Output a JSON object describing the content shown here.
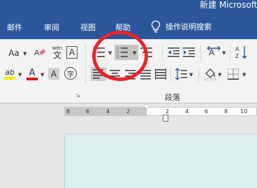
{
  "window": {
    "title": "新建 Microsoft"
  },
  "tabs": [
    "邮件",
    "审阅",
    "视图",
    "帮助"
  ],
  "tellme": {
    "label": "操作说明搜索",
    "icon": "lightbulb-icon"
  },
  "ribbon": {
    "font_group": {
      "font_size_icon": "Aa",
      "clear_format_icon": "eraser-icon",
      "phonetic_icon": "wén",
      "phonetic_char": "文",
      "char_border_icon": "A",
      "char_enclose_icon": "字",
      "highlight_icon": "ab",
      "highlight_color": "#f5ec00",
      "font_color_icon": "A",
      "font_color": "#d7191c",
      "char_shading_icon": "A"
    },
    "paragraph_group": {
      "label": "段落"
    }
  },
  "ruler": {
    "ticks": [
      "8",
      "6",
      "4",
      "2",
      "2",
      "4",
      "6",
      "8",
      "10"
    ]
  },
  "annotation": {
    "color": "#e8242b"
  }
}
